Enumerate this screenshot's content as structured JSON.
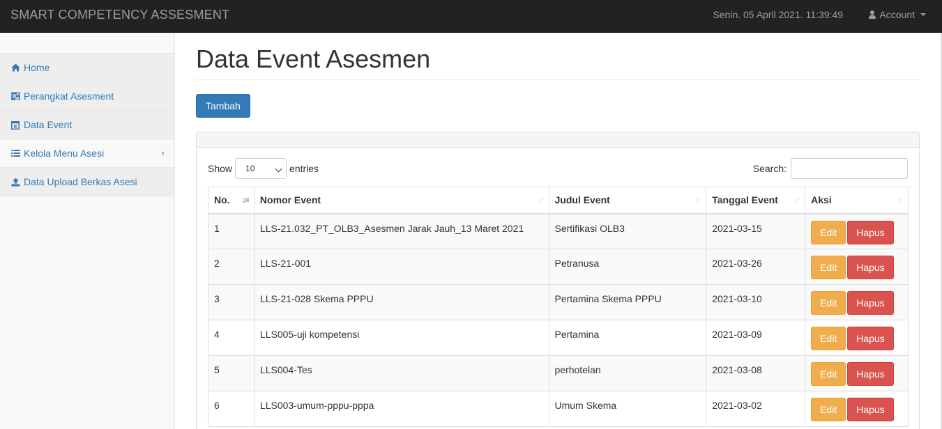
{
  "app": {
    "title": "SMART COMPETENCY ASSESMENT",
    "datetime": "Senin. 05 April 2021. 11:39:49",
    "account_label": "Account"
  },
  "sidebar": {
    "items": [
      {
        "label": "Home",
        "icon": "home-icon"
      },
      {
        "label": "Perangkat Asesment",
        "icon": "tasks-icon"
      },
      {
        "label": "Data Event",
        "icon": "calendar-icon"
      },
      {
        "label": "Kelola Menu Asesi",
        "icon": "list-icon"
      },
      {
        "label": "Data Upload Berkas Asesi",
        "icon": "upload-icon"
      }
    ]
  },
  "main": {
    "title": "Data Event Asesmen",
    "add_button": "Tambah",
    "show_label": "Show",
    "entries_value": "10",
    "entries_label": "entries",
    "search_label": "Search:",
    "search_value": ""
  },
  "table": {
    "columns": [
      "No.",
      "Nomor Event",
      "Judul Event",
      "Tanggal Event",
      "Aksi"
    ],
    "edit_label": "Edit",
    "delete_label": "Hapus",
    "rows": [
      {
        "no": "1",
        "nomor": "LLS-21.032_PT_OLB3_Asesmen Jarak Jauh_13 Maret 2021",
        "judul": "Sertifikasi OLB3",
        "tanggal": "2021-03-15"
      },
      {
        "no": "2",
        "nomor": "LLS-21-001",
        "judul": "Petranusa",
        "tanggal": "2021-03-26"
      },
      {
        "no": "3",
        "nomor": "LLS-21-028 Skema PPPU",
        "judul": "Pertamina Skema PPPU",
        "tanggal": "2021-03-10"
      },
      {
        "no": "4",
        "nomor": "LLS005-uji kompetensi",
        "judul": "Pertamina",
        "tanggal": "2021-03-09"
      },
      {
        "no": "5",
        "nomor": "LLS004-Tes",
        "judul": "perhotelan",
        "tanggal": "2021-03-08"
      },
      {
        "no": "6",
        "nomor": "LLS003-umum-pppu-pppa",
        "judul": "Umum Skema",
        "tanggal": "2021-03-02"
      }
    ]
  }
}
